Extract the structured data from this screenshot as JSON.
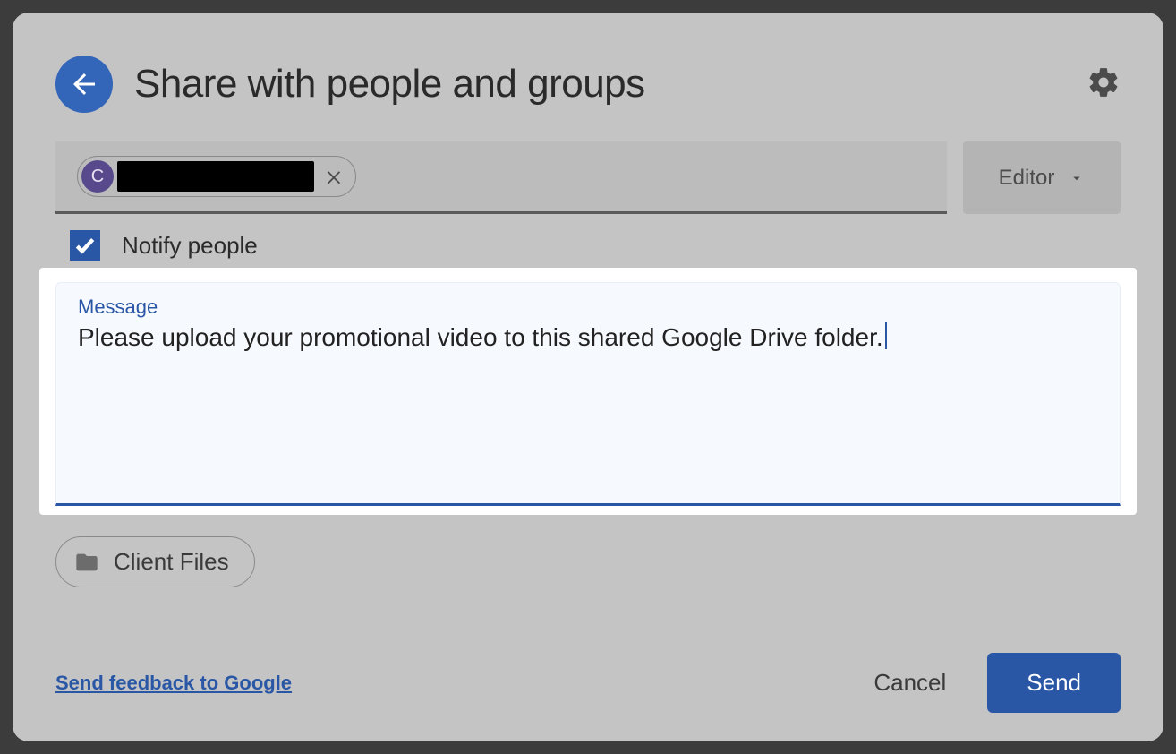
{
  "header": {
    "title": "Share with people and groups"
  },
  "recipients": {
    "chip_initial": "C",
    "chip_name_redacted": true
  },
  "role": {
    "selected": "Editor"
  },
  "notify": {
    "checked": true,
    "label": "Notify people"
  },
  "message": {
    "label": "Message",
    "text": "Please upload your promotional video to this shared Google Drive folder."
  },
  "attachment": {
    "name": "Client Files"
  },
  "footer": {
    "feedback": "Send feedback to Google",
    "cancel": "Cancel",
    "send": "Send"
  }
}
